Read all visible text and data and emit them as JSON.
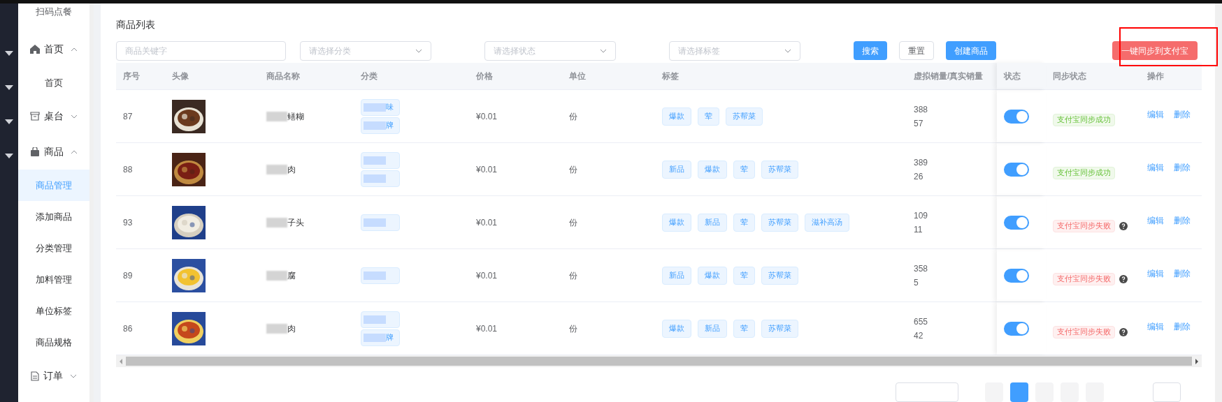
{
  "sidebar": {
    "title": "扫码点餐",
    "items": [
      {
        "label": "首页",
        "expanded": true,
        "children": [
          {
            "label": "首页",
            "selected": false
          }
        ]
      },
      {
        "label": "桌台",
        "expanded": false
      },
      {
        "label": "商品",
        "expanded": true,
        "children": [
          {
            "label": "商品管理",
            "selected": true
          },
          {
            "label": "添加商品",
            "selected": false
          },
          {
            "label": "分类管理",
            "selected": false
          },
          {
            "label": "加料管理",
            "selected": false
          },
          {
            "label": "单位标签",
            "selected": false
          },
          {
            "label": "商品规格",
            "selected": false
          }
        ]
      },
      {
        "label": "订单",
        "expanded": false
      }
    ]
  },
  "page_title": "商品列表",
  "filters": [
    {
      "kind": "input",
      "placeholder": "商品关键字"
    },
    {
      "kind": "select",
      "placeholder": "请选择分类"
    },
    {
      "kind": "select",
      "placeholder": "请选择状态"
    },
    {
      "kind": "select",
      "placeholder": "请选择标签"
    }
  ],
  "buttons": [
    {
      "label": "搜索",
      "kind": "primary"
    },
    {
      "label": "重置",
      "kind": "default"
    },
    {
      "label": "创建商品",
      "kind": "primary"
    }
  ],
  "sync_button": {
    "label": "一键同步到支付宝",
    "highlighted": true
  },
  "table": {
    "columns": [
      "序号",
      "头像",
      "商品名称",
      "分类",
      "价格",
      "单位",
      "标签",
      "虚拟销量/真实销量",
      "状态",
      "同步状态",
      "操作"
    ],
    "rows": [
      {
        "id": "87",
        "image": {
          "kind": "picture"
        },
        "name": "鳝糊",
        "categories": [
          {
            "masked": true,
            "text": "味"
          },
          {
            "masked": true,
            "text": "牌"
          }
        ],
        "price": "¥0.01",
        "unit": "份",
        "tags": [
          "爆款",
          "荤",
          "苏帮菜"
        ],
        "virtual_sales": "388",
        "real_sales": "57",
        "on": true,
        "sync": {
          "success": true,
          "label": "支付宝同步成功"
        },
        "actions": [
          "编辑",
          "删除"
        ]
      },
      {
        "id": "88",
        "image": {
          "kind": "picture"
        },
        "name": "肉",
        "categories": [
          {
            "masked": true
          },
          {
            "masked": true
          }
        ],
        "price": "¥0.01",
        "unit": "份",
        "tags": [
          "新品",
          "爆款",
          "荤",
          "苏帮菜"
        ],
        "virtual_sales": "389",
        "real_sales": "26",
        "on": true,
        "sync": {
          "success": true,
          "label": "支付宝同步成功"
        },
        "actions": [
          "编辑",
          "删除"
        ]
      },
      {
        "id": "93",
        "image": {
          "kind": "picture"
        },
        "name": "子头",
        "categories": [
          {
            "masked": true
          }
        ],
        "price": "¥0.01",
        "unit": "份",
        "tags": [
          "爆款",
          "新品",
          "荤",
          "苏帮菜",
          "滋补高汤"
        ],
        "virtual_sales": "109",
        "real_sales": "11",
        "on": true,
        "sync": {
          "success": false,
          "label": "支付宝同步失败"
        },
        "actions": [
          "编辑",
          "删除"
        ]
      },
      {
        "id": "89",
        "image": {
          "kind": "picture"
        },
        "name": "腐",
        "categories": [
          {
            "masked": true
          }
        ],
        "price": "¥0.01",
        "unit": "份",
        "tags": [
          "新品",
          "爆款",
          "荤",
          "苏帮菜"
        ],
        "virtual_sales": "358",
        "real_sales": "5",
        "on": true,
        "sync": {
          "success": false,
          "label": "支付宝同步失败"
        },
        "actions": [
          "编辑",
          "删除"
        ]
      },
      {
        "id": "86",
        "image": {
          "kind": "picture"
        },
        "name": "肉",
        "categories": [
          {
            "masked": true
          },
          {
            "masked": true,
            "text": "牌"
          }
        ],
        "price": "¥0.01",
        "unit": "份",
        "tags": [
          "爆款",
          "新品",
          "荤",
          "苏帮菜"
        ],
        "virtual_sales": "655",
        "real_sales": "42",
        "on": true,
        "sync": {
          "success": false,
          "label": "支付宝同步失败"
        },
        "actions": [
          "编辑",
          "删除"
        ]
      }
    ]
  },
  "pagination": {
    "pages": [
      {
        "selected": true
      },
      {
        "selected": false
      },
      {
        "selected": false
      }
    ]
  }
}
